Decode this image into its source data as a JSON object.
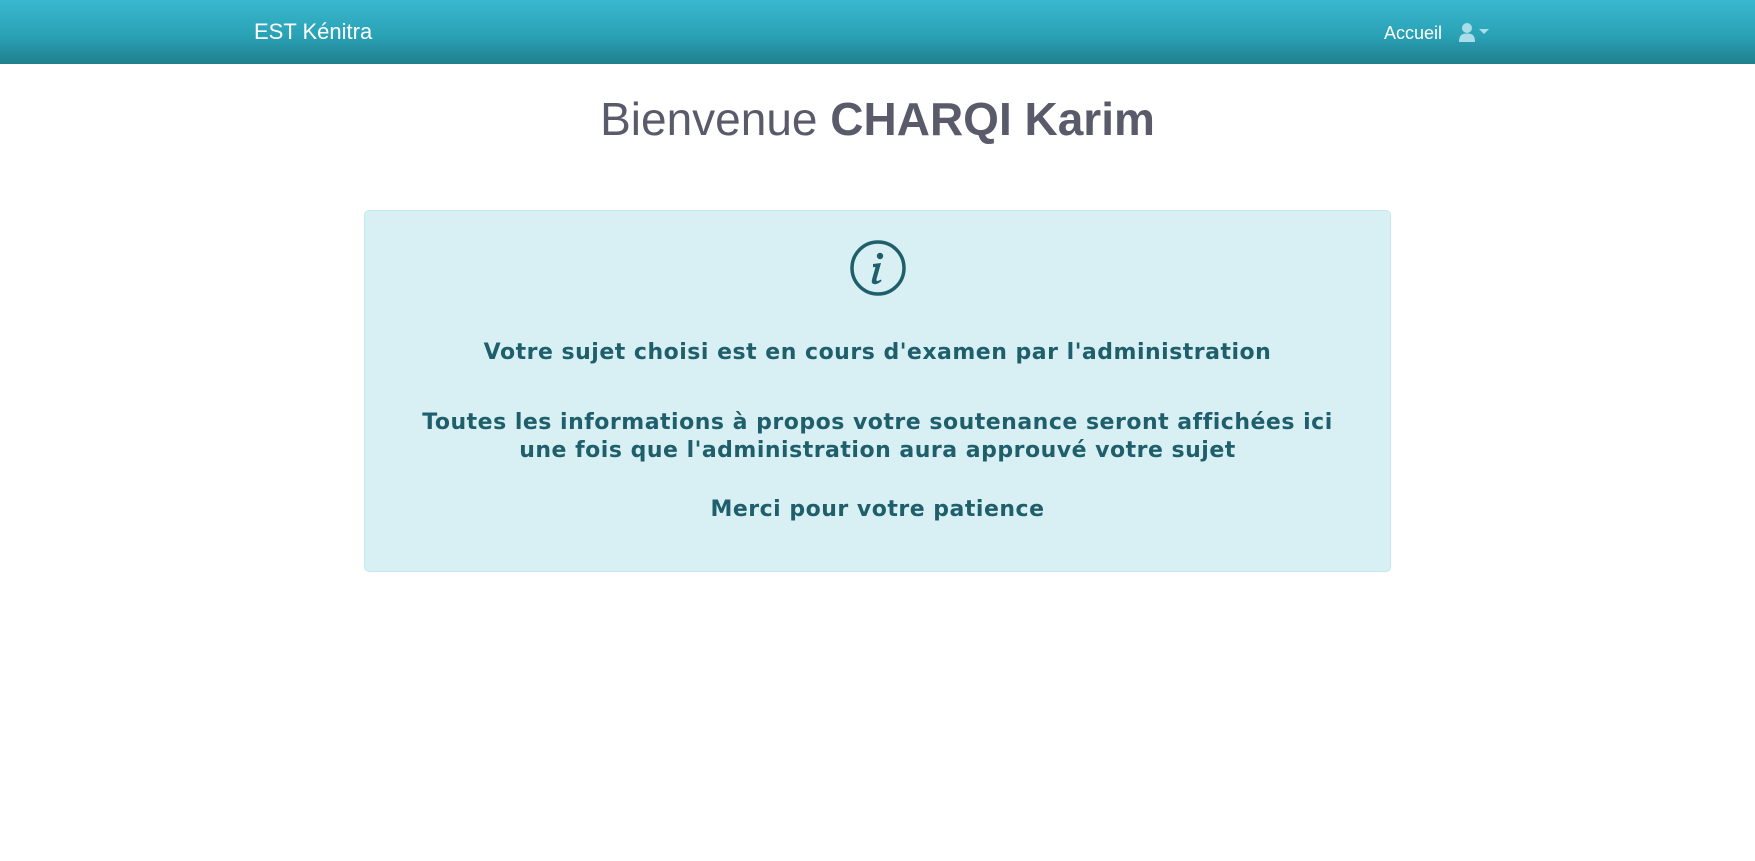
{
  "navbar": {
    "brand": "EST Kénitra",
    "home_link": "Accueil",
    "user_menu_icon": "user-icon",
    "caret_icon": "caret-down-icon"
  },
  "welcome": {
    "prefix": "Bienvenue ",
    "name": "CHARQI Karim"
  },
  "alert": {
    "icon": "info-icon",
    "line1": "Votre sujet choisi est en cours d'examen par l'administration",
    "line2": "Toutes les informations à propos votre soutenance seront affichées ici une fois que l'administration aura approuvé votre sujet",
    "line3": "Merci pour votre patience"
  },
  "colors": {
    "navbar_top": "#39b8cf",
    "navbar_bottom": "#1f7f8d",
    "alert_bg": "#d8f0f4",
    "alert_text": "#1f5f6b",
    "heading_text": "#5a5b6a"
  }
}
